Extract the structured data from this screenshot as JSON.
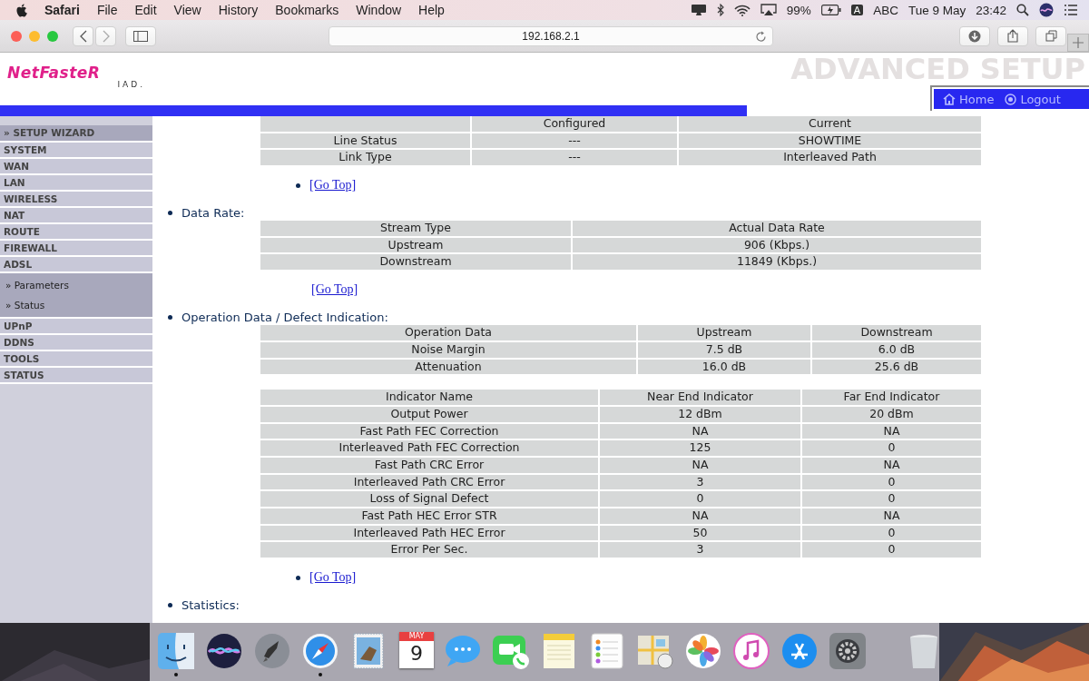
{
  "menubar": {
    "app": "Safari",
    "menus": [
      "File",
      "Edit",
      "View",
      "History",
      "Bookmarks",
      "Window",
      "Help"
    ],
    "status": [
      {
        "kind": "display"
      },
      {
        "kind": "bluetooth"
      },
      {
        "kind": "wifi"
      },
      {
        "kind": "airplay"
      },
      {
        "kind": "text",
        "label": "99%"
      },
      {
        "kind": "battery"
      },
      {
        "kind": "input-badge",
        "label": "A"
      },
      {
        "kind": "text",
        "label": "ABC"
      },
      {
        "kind": "text",
        "label": "Tue 9 May"
      },
      {
        "kind": "text",
        "label": "23:42"
      },
      {
        "kind": "search"
      },
      {
        "kind": "siri"
      },
      {
        "kind": "list"
      }
    ]
  },
  "browser": {
    "url": "192.168.2.1"
  },
  "header": {
    "logo": "NetFasteR",
    "logo_sub": "IAD.",
    "title": "ADVANCED SETUP",
    "nav": [
      {
        "kind": "home",
        "label": "Home"
      },
      {
        "kind": "logout",
        "label": "Logout"
      }
    ]
  },
  "sidebar": {
    "items": [
      {
        "kind": "wizard",
        "label": "» SETUP WIZARD"
      },
      {
        "kind": "section",
        "label": "SYSTEM"
      },
      {
        "kind": "section",
        "label": "WAN"
      },
      {
        "kind": "section",
        "label": "LAN"
      },
      {
        "kind": "section",
        "label": "WIRELESS"
      },
      {
        "kind": "section",
        "label": "NAT"
      },
      {
        "kind": "section",
        "label": "ROUTE"
      },
      {
        "kind": "section",
        "label": "FIREWALL"
      },
      {
        "kind": "section",
        "label": "ADSL",
        "expanded": true,
        "children": [
          {
            "label": "» Parameters"
          },
          {
            "label": "» Status"
          }
        ]
      },
      {
        "kind": "section",
        "label": "UPnP"
      },
      {
        "kind": "section",
        "label": "DDNS"
      },
      {
        "kind": "section",
        "label": "TOOLS"
      },
      {
        "kind": "section",
        "label": "STATUS"
      }
    ]
  },
  "content": {
    "blocks": [
      {
        "kind": "table",
        "columns": [
          null,
          "Configured",
          "Current"
        ],
        "rows": [
          [
            "Line Status",
            "---",
            "SHOWTIME"
          ],
          [
            "Link Type",
            "---",
            "Interleaved Path"
          ]
        ]
      },
      {
        "kind": "link",
        "label": "[Go Top]",
        "bullet": true
      },
      {
        "kind": "heading",
        "label": "Data Rate:"
      },
      {
        "kind": "table",
        "columns": [
          "Stream Type",
          "Actual Data Rate"
        ],
        "rows": [
          [
            "Upstream",
            "906 (Kbps.)"
          ],
          [
            "Downstream",
            "11849 (Kbps.)"
          ]
        ]
      },
      {
        "kind": "link",
        "label": "[Go Top]",
        "bullet": false
      },
      {
        "kind": "heading",
        "label": "Operation Data / Defect Indication:"
      },
      {
        "kind": "table",
        "columns": [
          "Operation Data",
          "Upstream",
          "Downstream"
        ],
        "rows": [
          [
            "Noise Margin",
            "7.5 dB",
            "6.0 dB"
          ],
          [
            "Attenuation",
            "16.0 dB",
            "25.6 dB"
          ]
        ]
      },
      {
        "kind": "table",
        "columns": [
          "Indicator Name",
          "Near End Indicator",
          "Far End Indicator"
        ],
        "rows": [
          [
            "Output Power",
            "12 dBm",
            "20 dBm"
          ],
          [
            "Fast Path FEC Correction",
            "NA",
            "NA"
          ],
          [
            "Interleaved Path FEC Correction",
            "125",
            "0"
          ],
          [
            "Fast Path CRC Error",
            "NA",
            "NA"
          ],
          [
            "Interleaved Path CRC Error",
            "3",
            "0"
          ],
          [
            "Loss of Signal Defect",
            "0",
            "0"
          ],
          [
            "Fast Path HEC Error STR",
            "NA",
            "NA"
          ],
          [
            "Interleaved Path HEC Error",
            "50",
            "0"
          ],
          [
            "Error Per Sec.",
            "3",
            "0"
          ]
        ]
      },
      {
        "kind": "link",
        "label": "[Go Top]",
        "bullet": true
      },
      {
        "kind": "heading",
        "label": "Statistics:"
      }
    ]
  },
  "dock": {
    "items": [
      {
        "kind": "finder",
        "running": true
      },
      {
        "kind": "siri",
        "running": false
      },
      {
        "kind": "launchpad",
        "running": false
      },
      {
        "kind": "safari",
        "running": true
      },
      {
        "kind": "mail",
        "running": false
      },
      {
        "kind": "calendar",
        "running": false,
        "month": "MAY",
        "day": "9"
      },
      {
        "kind": "messages",
        "running": false
      },
      {
        "kind": "facetime",
        "running": false
      },
      {
        "kind": "notes",
        "running": false
      },
      {
        "kind": "reminders",
        "running": false
      },
      {
        "kind": "maps",
        "running": false
      },
      {
        "kind": "photos",
        "running": false
      },
      {
        "kind": "itunes",
        "running": false
      },
      {
        "kind": "appstore",
        "running": false
      },
      {
        "kind": "preferences",
        "running": false
      },
      {
        "kind": "divider"
      },
      {
        "kind": "trash",
        "running": false
      }
    ]
  }
}
